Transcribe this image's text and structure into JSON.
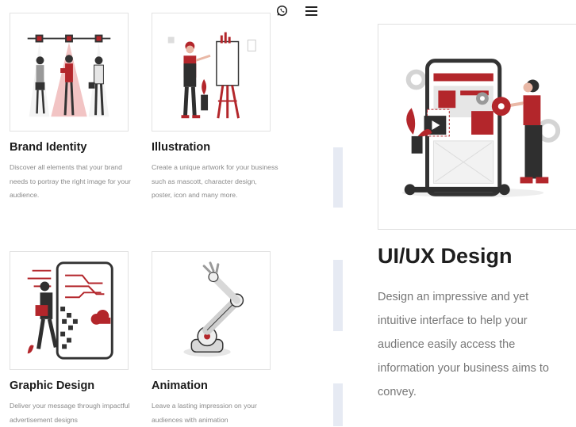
{
  "header": {
    "whatsapp_icon": "whatsapp-icon",
    "menu_icon": "hamburger-menu-icon"
  },
  "services": [
    {
      "title": "Brand Identity",
      "desc": "Discover all elements that your brand needs to portray the right image for your audience."
    },
    {
      "title": "Illustration",
      "desc": "Create a unique artwork for your business such as mascott, character design, poster, icon and many more."
    },
    {
      "title": "Graphic Design",
      "desc": "Deliver your message through impactful advertisement designs"
    },
    {
      "title": "Animation",
      "desc": "Leave a lasting impression on your audiences with animation"
    }
  ],
  "featured": {
    "title": "UI/UX Design",
    "desc": "Design an impressive and yet\nintuitive interface to help your\naudience easily access the\ninformation your business aims to\nconvey."
  },
  "colors": {
    "accent": "#b3262b",
    "dark": "#2f2f2f",
    "divider": "#e6eaf3"
  }
}
